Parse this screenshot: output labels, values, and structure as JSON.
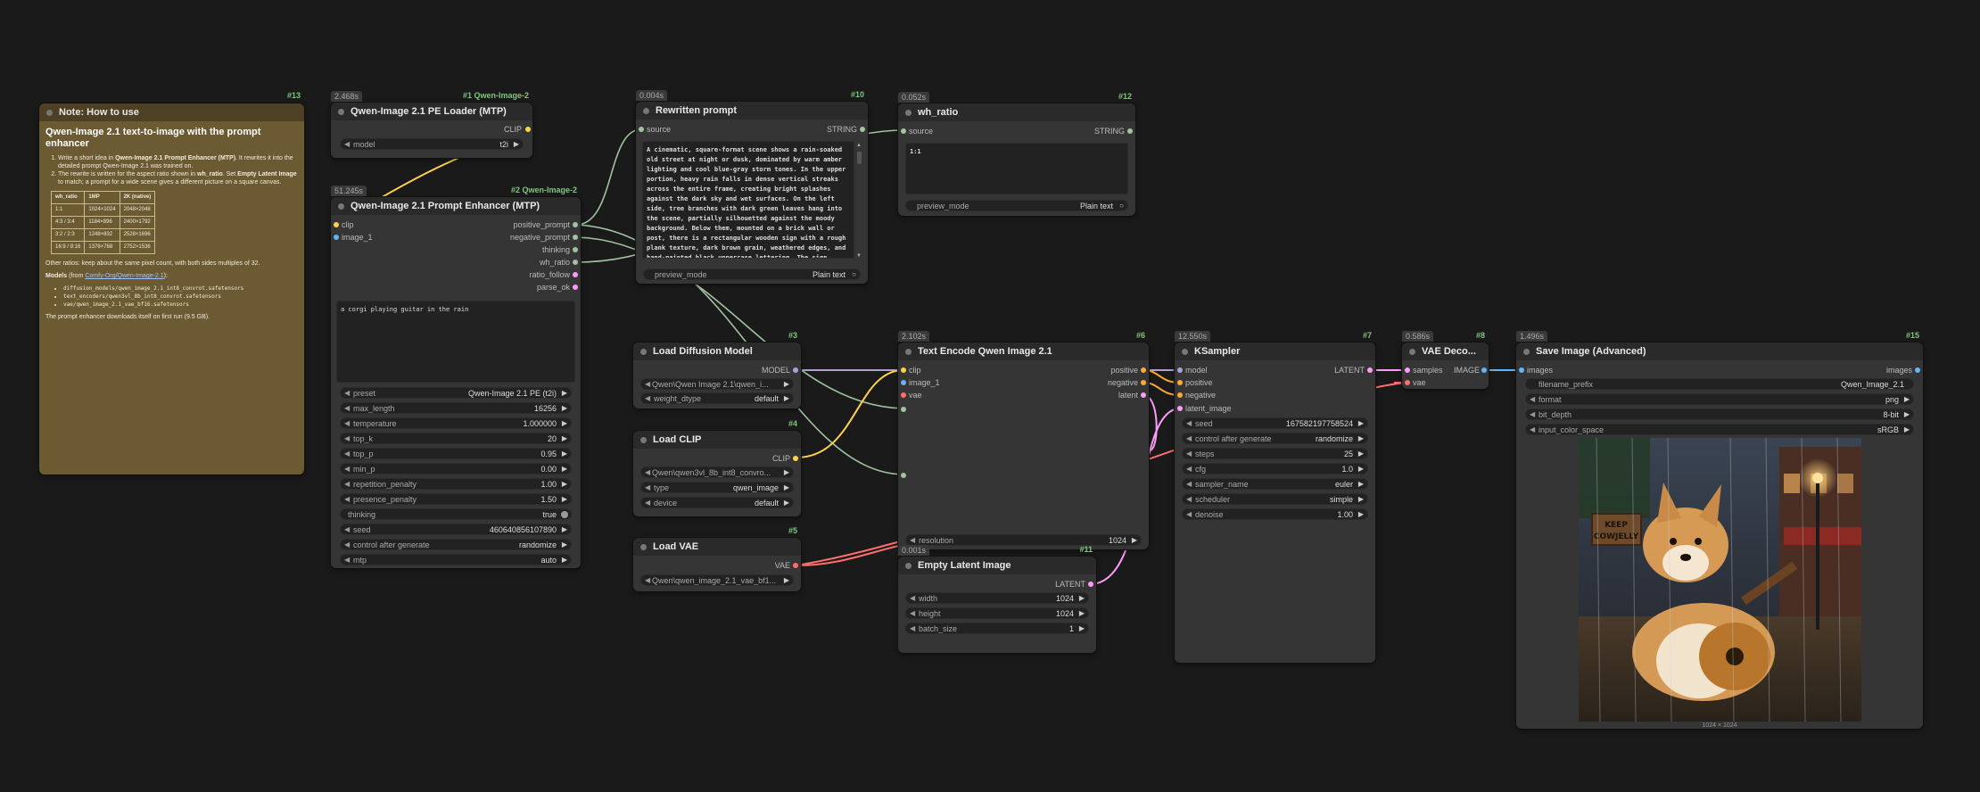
{
  "colors": {
    "background": "#1a1a1a",
    "node": "#353535",
    "note": "#6b5a32",
    "wire_model": "#b39ddb",
    "wire_clip": "#ffd24c",
    "wire_vae": "#ff6e6e",
    "wire_latent": "#ff9cf9",
    "wire_cond": "#ffa931",
    "wire_string": "#a0c4a0",
    "wire_image": "#64b5f6"
  },
  "note": {
    "id": "#13",
    "title": "Note: How to use",
    "heading": "Qwen-Image 2.1 text-to-image with the prompt enhancer",
    "step1_a": "Write a short idea in ",
    "step1_b": "Qwen-Image 2.1 Prompt Enhancer (MTP)",
    "step1_c": ". It rewrites it into the detailed prompt Qwen-Image 2.1 was trained on.",
    "step2_a": "The rewrite is written for the aspect ratio shown in ",
    "step2_b": "wh_ratio",
    "step2_c": ". Set ",
    "step2_d": "Empty Latent Image",
    "step2_e": " to match; a prompt for a wide scene gives a different picture on a square canvas.",
    "table_headers": [
      "wh_ratio",
      "1MP",
      "2K (native)"
    ],
    "table_rows": [
      [
        "1:1",
        "1024×1024",
        "2048×2048"
      ],
      [
        "4:3 / 3:4",
        "1184×896",
        "2400×1792"
      ],
      [
        "3:2 / 2:3",
        "1248×832",
        "2528×1696"
      ],
      [
        "16:9 / 9:16",
        "1376×768",
        "2752×1536"
      ]
    ],
    "other_ratios": "Other ratios: keep about the same pixel count, with both sides multiples of 32.",
    "models_label": "Models",
    "models_from": " (from ",
    "models_link": "Comfy-Org/Qwen-Image-2.1",
    "models_close": "):",
    "model_files": [
      "diffusion_models/qwen_image_2.1_int8_convrot.safetensors",
      "text_encoders/qwen3vl_8b_int8_convrot.safetensors",
      "vae/qwen_image_2.1_vae_bf16.safetensors"
    ],
    "footer": "The prompt enhancer downloads itself on first run (9.5 GB)."
  },
  "pe_loader": {
    "badge": "2.468s",
    "id": "#1 Qwen-Image-2",
    "title": "Qwen-Image 2.1 PE Loader (MTP)",
    "output": "CLIP",
    "model_label": "model",
    "model_value": "t2i"
  },
  "enhancer": {
    "badge": "51.245s",
    "id": "#2 Qwen-Image-2",
    "title": "Qwen-Image 2.1 Prompt Enhancer (MTP)",
    "inputs": [
      "clip",
      "image_1"
    ],
    "outputs": [
      "positive_prompt",
      "negative_prompt",
      "thinking",
      "wh_ratio",
      "ratio_follow",
      "parse_ok"
    ],
    "prompt": "a corgi playing guitar in the rain",
    "widgets": [
      {
        "label": "preset",
        "value": "Qwen-Image 2.1 PE (t2i)"
      },
      {
        "label": "max_length",
        "value": "16256"
      },
      {
        "label": "temperature",
        "value": "1.000000"
      },
      {
        "label": "top_k",
        "value": "20"
      },
      {
        "label": "top_p",
        "value": "0.95"
      },
      {
        "label": "min_p",
        "value": "0.00"
      },
      {
        "label": "repetition_penalty",
        "value": "1.00"
      },
      {
        "label": "presence_penalty",
        "value": "1.50"
      },
      {
        "label": "thinking",
        "value": "true"
      },
      {
        "label": "seed",
        "value": "460640856107890"
      },
      {
        "label": "control after generate",
        "value": "randomize"
      },
      {
        "label": "mtp",
        "value": "auto"
      }
    ]
  },
  "rewritten": {
    "badge": "0.004s",
    "id": "#10",
    "title": "Rewritten prompt",
    "input": "source",
    "output": "STRING",
    "text": "A cinematic, square-format scene shows a rain-soaked old street at night or dusk, dominated by warm amber lighting and cool blue-gray storm tones. In the upper portion, heavy rain falls in dense vertical streaks across the entire frame, creating bright splashes against the dark sky and wet surfaces. On the left side, tree branches with dark green leaves hang into the scene, partially silhouetted against the moody background. Below them, mounted on a brick wall or post, there is a rectangular wooden sign with a rough plank texture, dark brown grain, weathered edges, and hand-painted black uppercase lettering. The sign contains the",
    "preview_label": "preview_mode",
    "preview_value": "Plain text"
  },
  "wh_ratio": {
    "badge": "0.052s",
    "id": "#12",
    "title": "wh_ratio",
    "input": "source",
    "output": "STRING",
    "text": "1:1",
    "preview_label": "preview_mode",
    "preview_value": "Plain text"
  },
  "load_diffusion": {
    "id": "#3",
    "title": "Load Diffusion Model",
    "output": "MODEL",
    "widgets": [
      {
        "label": "",
        "value": "Qwen\\Qwen Image 2.1\\qwen_i..."
      },
      {
        "label": "weight_dtype",
        "value": "default"
      }
    ]
  },
  "load_clip": {
    "id": "#4",
    "title": "Load CLIP",
    "output": "CLIP",
    "widgets": [
      {
        "label": "",
        "value": "Qwen\\qwen3vl_8b_int8_convro..."
      },
      {
        "label": "type",
        "value": "qwen_image"
      },
      {
        "label": "device",
        "value": "default"
      }
    ]
  },
  "load_vae": {
    "id": "#5",
    "title": "Load VAE",
    "output": "VAE",
    "widgets": [
      {
        "label": "",
        "value": "Qwen\\qwen_image_2.1_vae_bf1..."
      }
    ]
  },
  "text_encode": {
    "badge": "2.102s",
    "id": "#6",
    "title": "Text Encode Qwen Image 2.1",
    "inputs": [
      "clip",
      "image_1",
      "vae"
    ],
    "outputs": [
      "positive",
      "negative",
      "latent"
    ],
    "resolution_label": "resolution",
    "resolution_value": "1024"
  },
  "empty_latent": {
    "badge": "0.001s",
    "id": "#11",
    "title": "Empty Latent Image",
    "output": "LATENT",
    "widgets": [
      {
        "label": "width",
        "value": "1024"
      },
      {
        "label": "height",
        "value": "1024"
      },
      {
        "label": "batch_size",
        "value": "1"
      }
    ]
  },
  "ksampler": {
    "badge": "12.550s",
    "id": "#7",
    "title": "KSampler",
    "inputs": [
      "model",
      "positive",
      "negative",
      "latent_image"
    ],
    "output": "LATENT",
    "widgets": [
      {
        "label": "seed",
        "value": "167582197758524"
      },
      {
        "label": "control after generate",
        "value": "randomize"
      },
      {
        "label": "steps",
        "value": "25"
      },
      {
        "label": "cfg",
        "value": "1.0"
      },
      {
        "label": "sampler_name",
        "value": "euler"
      },
      {
        "label": "scheduler",
        "value": "simple"
      },
      {
        "label": "denoise",
        "value": "1.00"
      }
    ]
  },
  "vae_decode": {
    "badge": "0.586s",
    "id": "#8",
    "title": "VAE Deco...",
    "inputs": [
      "samples",
      "vae"
    ],
    "output": "IMAGE"
  },
  "save_image": {
    "badge": "1.496s",
    "id": "#15",
    "title": "Save Image (Advanced)",
    "input": "images",
    "output": "images",
    "widgets": [
      {
        "label": "filename_prefix",
        "value": "Qwen_Image_2.1"
      },
      {
        "label": "format",
        "value": "png"
      },
      {
        "label": "bit_depth",
        "value": "8-bit"
      },
      {
        "label": "input_color_space",
        "value": "sRGB"
      }
    ],
    "sign_line1": "KEEP",
    "sign_line2": "COWJELLY",
    "caption": "1024 × 1024"
  }
}
